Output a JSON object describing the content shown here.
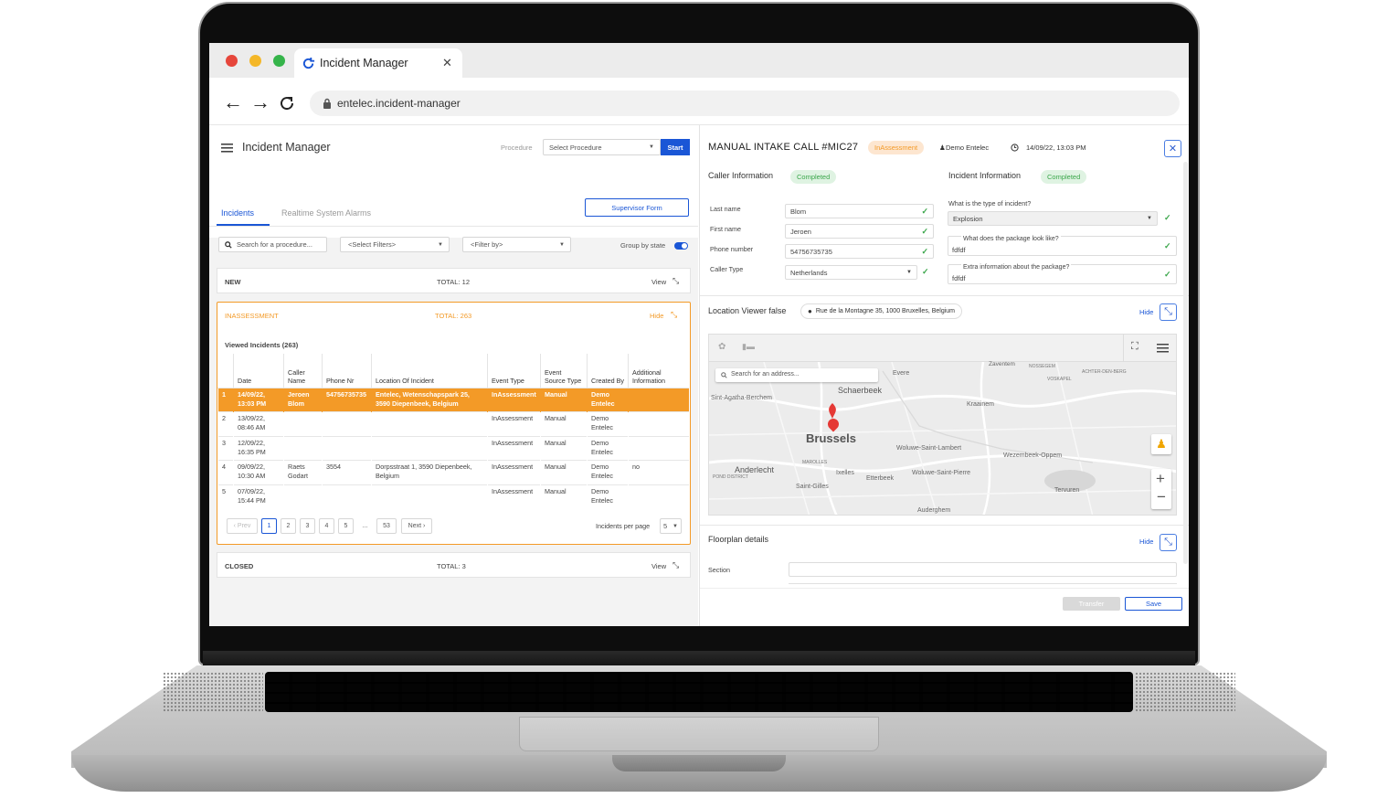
{
  "browser": {
    "tab_title": "Incident Manager",
    "tab_close": "✕",
    "url": "entelec.incident-manager"
  },
  "app": {
    "title": "Incident Manager",
    "procedure_label": "Procedure",
    "procedure_select": "Select Procedure",
    "start_button": "Start",
    "supervisor_button": "Supervisor Form",
    "tabs": [
      {
        "label": "Incidents",
        "active": true
      },
      {
        "label": "Realtime System Alarms",
        "active": false
      }
    ],
    "search_placeholder": "Search for a procedure...",
    "filters_select": "<Select Filters>",
    "filterby_select": "<Filter by>",
    "group_by_state_label": "Group by state",
    "group_by_state_on": true
  },
  "groups": {
    "new": {
      "label": "NEW",
      "total": "TOTAL: 12",
      "action": "View"
    },
    "inassessment": {
      "label": "INASSESSMENT",
      "total": "TOTAL: 263",
      "action": "Hide",
      "viewed": "Viewed Incidents (263)"
    },
    "closed": {
      "label": "CLOSED",
      "total": "TOTAL: 3",
      "action": "View"
    }
  },
  "table": {
    "columns": [
      "",
      "Date",
      "Caller Name",
      "Phone Nr",
      "Location Of Incident",
      "Event Type",
      "Event Source Type",
      "Created By",
      "Additional Information"
    ],
    "rows": [
      {
        "n": "1",
        "date": "14/09/22, 13:03 PM",
        "caller": "Jeroen Blom",
        "phone": "54756735735",
        "location": "Entelec, Wetenschapspark 25, 3590 Diepenbeek, Belgium",
        "event": "InAssessment",
        "source": "Manual",
        "created": "Demo Entelec",
        "info": "",
        "highlight": true
      },
      {
        "n": "2",
        "date": "13/09/22, 08:46 AM",
        "caller": "",
        "phone": "",
        "location": "",
        "event": "InAssessment",
        "source": "Manual",
        "created": "Demo Entelec",
        "info": "",
        "highlight": false
      },
      {
        "n": "3",
        "date": "12/09/22, 16:35 PM",
        "caller": "",
        "phone": "",
        "location": "",
        "event": "InAssessment",
        "source": "Manual",
        "created": "Demo Entelec",
        "info": "",
        "highlight": false
      },
      {
        "n": "4",
        "date": "09/09/22, 10:30 AM",
        "caller": "Raets Godart",
        "phone": "3554",
        "location": "Dorpsstraat 1, 3590 Diepenbeek, Belgium",
        "event": "InAssessment",
        "source": "Manual",
        "created": "Demo Entelec",
        "info": "no",
        "highlight": false
      },
      {
        "n": "5",
        "date": "07/09/22, 15:44 PM",
        "caller": "",
        "phone": "",
        "location": "",
        "event": "InAssessment",
        "source": "Manual",
        "created": "Demo Entelec",
        "info": "",
        "highlight": false
      }
    ]
  },
  "pagination": {
    "prev": "‹ Prev",
    "pages": [
      "1",
      "2",
      "3",
      "4",
      "5",
      "...",
      "53"
    ],
    "current": "1",
    "next": "Next ›",
    "per_page_label": "Incidents per page",
    "per_page": "5"
  },
  "detail": {
    "title": "MANUAL INTAKE CALL #MIC27",
    "status_badge": "InAssessment",
    "user": "Demo Entelec",
    "datetime": "14/09/22, 13:03 PM",
    "caller_section": "Caller Information",
    "caller_status": "Completed",
    "incident_section": "Incident Information",
    "incident_status": "Completed",
    "caller_fields": [
      {
        "label": "Last name",
        "value": "Blom"
      },
      {
        "label": "First name",
        "value": "Jeroen"
      },
      {
        "label": "Phone number",
        "value": "54756735735"
      },
      {
        "label": "Caller Type",
        "value": "Netherlands"
      }
    ],
    "incident_q1": "What is the type of incident?",
    "incident_a1": "Explosion",
    "incident_q2": "What does the package look like?",
    "incident_a2": "fdfdf",
    "incident_q3": "Extra information about the package?",
    "incident_a3": "fdfdf",
    "location_title": "Location Viewer false",
    "location_address": "Rue de la Montagne 35, 1000 Bruxelles, Belgium",
    "location_action": "Hide",
    "map_search_placeholder": "Search for an address...",
    "map_labels": {
      "city": "Brussels",
      "schaerbeek": "Schaerbeek",
      "anderlecht": "Anderlecht",
      "zaventem": "Zaventem",
      "kraainem": "Kraainem",
      "woluwe_lambert": "Woluwe-Saint-Lambert",
      "woluwe_pierre": "Woluwe-Saint-Pierre",
      "wezembeek": "Wezembeek-Oppem",
      "sint_agatha": "Sint-Agatha-Berchem",
      "etterbeek": "Etterbeek",
      "ixelles": "Ixelles",
      "saint_gilles": "Saint-Gilles",
      "auderghem": "Auderghem",
      "tervuren": "Tervuren",
      "evere": "Evere",
      "marolles": "MAROLLES",
      "nossegem": "NOSSEGEM",
      "achter": "ACHTER-DEN-BERG",
      "vorsel": "VOSKAPEL",
      "pond": "POND DISTRICT"
    },
    "floorplan_title": "Floorplan details",
    "floorplan_action": "Hide",
    "section_label": "Section",
    "transfer_button": "Transfer",
    "save_button": "Save"
  },
  "colors": {
    "accent": "#1a56d6",
    "orange": "#f39a27",
    "green_badge_bg": "#dff3e2",
    "green_badge_text": "#3aa64a",
    "orange_badge_bg": "#fde6d0"
  }
}
